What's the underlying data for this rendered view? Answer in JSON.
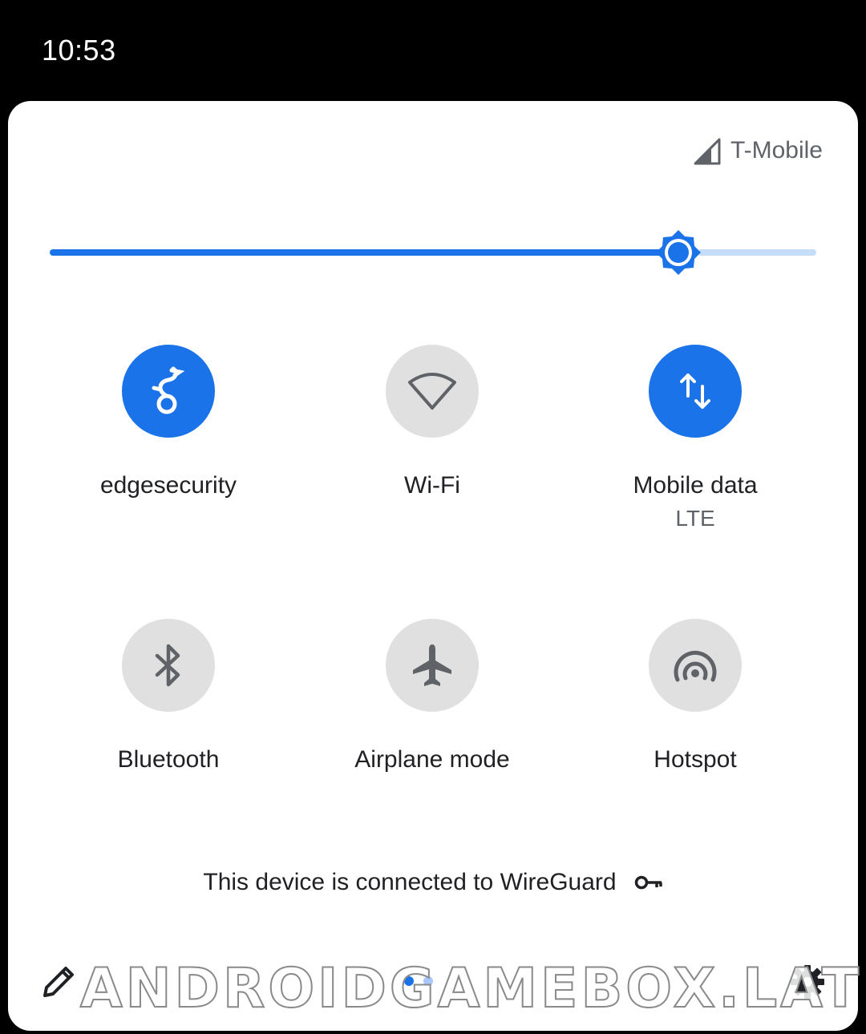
{
  "status_bar": {
    "time": "10:53"
  },
  "carrier": {
    "name": "T-Mobile",
    "icon": "cell-signal-icon"
  },
  "brightness": {
    "level_fraction": 0.82,
    "icon": "brightness-icon",
    "colors": {
      "active": "#1a73e8",
      "rest": "#c6dcfb"
    }
  },
  "tiles": [
    {
      "label": "edgesecurity",
      "sublabel": "",
      "state": "on",
      "icon": "wireguard-dragon-icon"
    },
    {
      "label": "Wi-Fi",
      "sublabel": "",
      "state": "off",
      "icon": "wifi-icon"
    },
    {
      "label": "Mobile data",
      "sublabel": "LTE",
      "state": "on",
      "icon": "mobile-data-arrows-icon"
    },
    {
      "label": "Bluetooth",
      "sublabel": "",
      "state": "off",
      "icon": "bluetooth-icon"
    },
    {
      "label": "Airplane mode",
      "sublabel": "",
      "state": "off",
      "icon": "airplane-icon"
    },
    {
      "label": "Hotspot",
      "sublabel": "",
      "state": "off",
      "icon": "hotspot-icon"
    }
  ],
  "vpn_notice": {
    "text": "This device is connected to WireGuard",
    "icon": "vpn-key-icon"
  },
  "footer": {
    "edit_icon": "pencil-icon",
    "settings_icon": "gear-icon",
    "pages": 2,
    "current_page": 1
  },
  "watermark": {
    "text": "ANDROIDGAMEBOX.LAT"
  },
  "colors": {
    "accent": "#1a73e8",
    "tile_off": "#e0e0e0",
    "panel": "#ffffff",
    "background": "#000000"
  }
}
